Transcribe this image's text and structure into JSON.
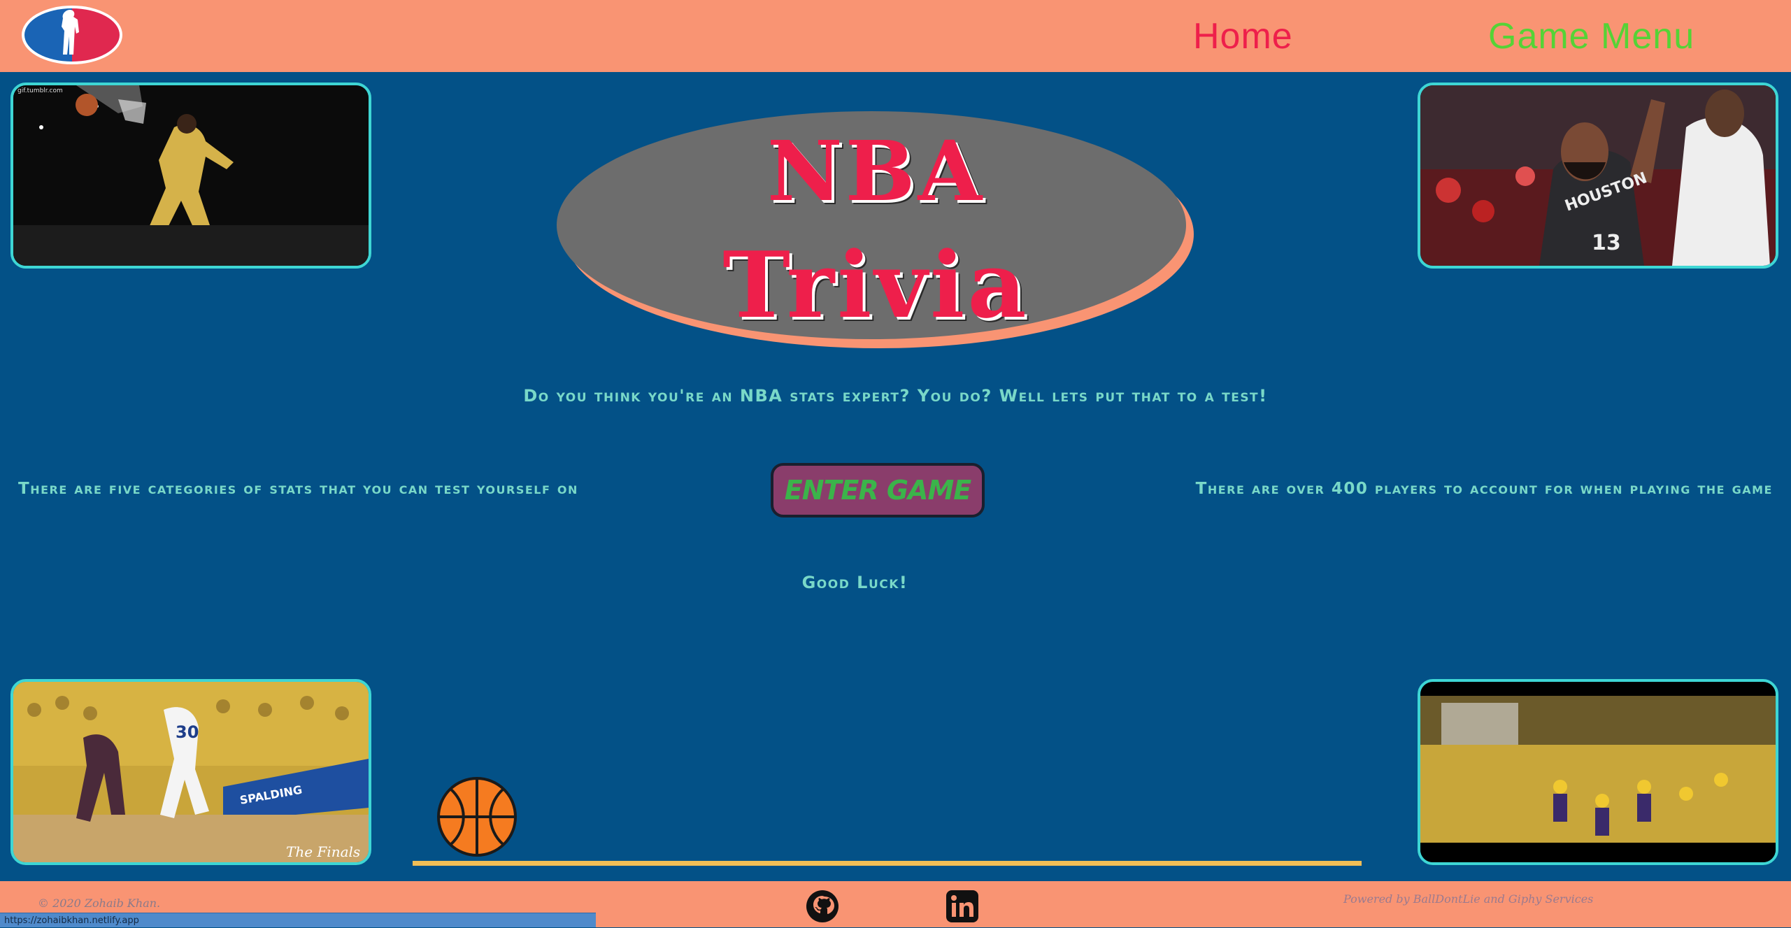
{
  "header": {
    "logo_icon": "nba-logo-icon",
    "nav": [
      {
        "label": "Home",
        "color": "#EE1F4B"
      },
      {
        "label": "Game Menu",
        "color": "#55D336"
      }
    ]
  },
  "gifs": {
    "top_left_watermark": "gif.tumblr.com",
    "top_right_player_text": "HOUSTON",
    "top_right_player_number": "13",
    "bottom_left_player_number": "30",
    "bottom_left_brand": "SPALDING",
    "bottom_left_logo_text": "The Finals"
  },
  "hero": {
    "title_line1": "NBA",
    "title_line2": "Trivia"
  },
  "content": {
    "intro": "Do you think you're an NBA stats expert? You do? Well lets put that to a test!",
    "left_info": "There are five categories of stats that you can test yourself on",
    "right_info": "There are over 400 players to account for when playing the game",
    "enter_button": "ENTER GAME",
    "good_luck": "Good Luck!"
  },
  "decor": {
    "ball_icon": "basketball-icon"
  },
  "footer": {
    "copyright": "© 2020 Zohaib Khan.",
    "powered_by": "Powered by BallDontLie and Giphy Services",
    "social": [
      "github-icon",
      "linkedin-icon"
    ]
  },
  "status_bar": {
    "url": "https://zohaibkhan.netlify.app"
  },
  "colors": {
    "page_bg": "#035187",
    "header_bg": "#F99473",
    "accent_red": "#EE1F4B",
    "accent_green": "#55D336",
    "text_teal": "#79D8C8",
    "border_cyan": "#3ED6D4",
    "track_yellow": "#F2BE56"
  }
}
